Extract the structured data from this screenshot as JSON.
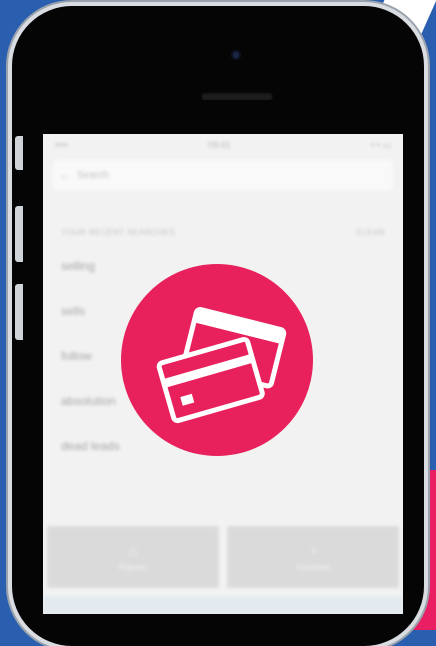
{
  "status_bar": {
    "left": "•••• ",
    "center": "09:41",
    "right": "• • ▭"
  },
  "search": {
    "placeholder": "Search"
  },
  "recent": {
    "title": "YOUR RECENT SEARCHES",
    "action": "CLEAR",
    "items": [
      "selling",
      "sells",
      "follow",
      "absolution",
      "dead leads"
    ]
  },
  "tabs": [
    {
      "icon": "home-icon",
      "glyph": "⌂",
      "label": "Popular"
    },
    {
      "icon": "user-icon",
      "glyph": "◔",
      "label": "Favorites"
    }
  ],
  "colors": {
    "background": "#2a5fb0",
    "accent": "#e8215c",
    "stripe": "#ffffff"
  },
  "badge_icon": "credit-cards-icon"
}
